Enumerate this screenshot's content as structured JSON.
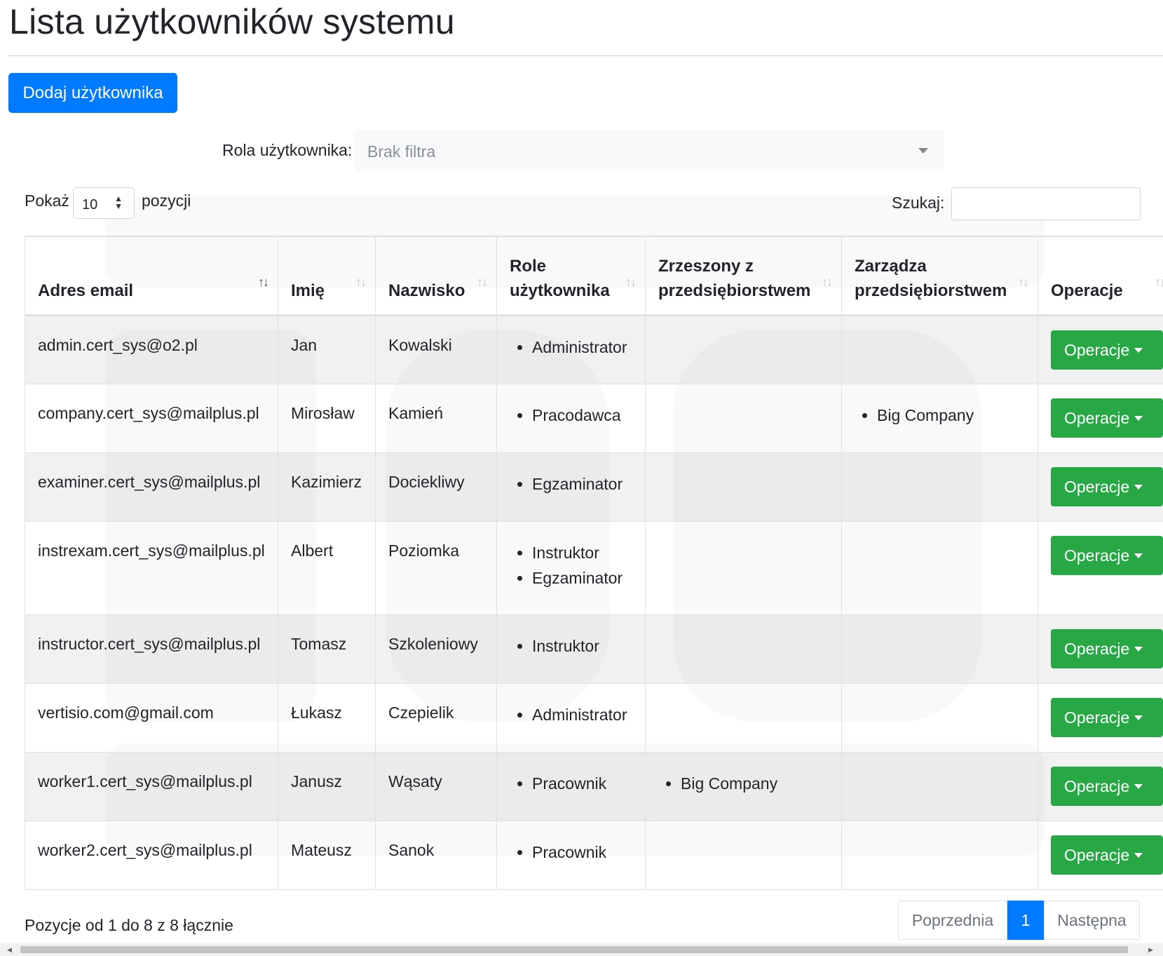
{
  "page": {
    "title": "Lista użytkowników systemu"
  },
  "toolbar": {
    "add_user_label": "Dodaj użytkownika"
  },
  "filter": {
    "label": "Rola użytkownika:",
    "value": "Brak filtra"
  },
  "length": {
    "prefix": "Pokaż",
    "value": "10",
    "suffix": "pozycji"
  },
  "search": {
    "label": "Szukaj:",
    "value": ""
  },
  "table": {
    "headers": {
      "email": "Adres email",
      "first_name": "Imię",
      "last_name": "Nazwisko",
      "roles": "Role użytkownika",
      "member_of": "Zrzeszony z przedsiębiorstwem",
      "manages": "Zarządza przedsiębiorstwem",
      "operations": "Operacje"
    },
    "rows": [
      {
        "email": "admin.cert_sys@o2.pl",
        "first_name": "Jan",
        "last_name": "Kowalski",
        "roles": [
          "Administrator"
        ],
        "member_of": [],
        "manages": [],
        "operations": "Operacje"
      },
      {
        "email": "company.cert_sys@mailplus.pl",
        "first_name": "Mirosław",
        "last_name": "Kamień",
        "roles": [
          "Pracodawca"
        ],
        "member_of": [],
        "manages": [
          "Big Company"
        ],
        "operations": "Operacje"
      },
      {
        "email": "examiner.cert_sys@mailplus.pl",
        "first_name": "Kazimierz",
        "last_name": "Dociekliwy",
        "roles": [
          "Egzaminator"
        ],
        "member_of": [],
        "manages": [],
        "operations": "Operacje"
      },
      {
        "email": "instrexam.cert_sys@mailplus.pl",
        "first_name": "Albert",
        "last_name": "Poziomka",
        "roles": [
          "Instruktor",
          "Egzaminator"
        ],
        "member_of": [],
        "manages": [],
        "operations": "Operacje"
      },
      {
        "email": "instructor.cert_sys@mailplus.pl",
        "first_name": "Tomasz",
        "last_name": "Szkoleniowy",
        "roles": [
          "Instruktor"
        ],
        "member_of": [],
        "manages": [],
        "operations": "Operacje"
      },
      {
        "email": "vertisio.com@gmail.com",
        "first_name": "Łukasz",
        "last_name": "Czepielik",
        "roles": [
          "Administrator"
        ],
        "member_of": [],
        "manages": [],
        "operations": "Operacje"
      },
      {
        "email": "worker1.cert_sys@mailplus.pl",
        "first_name": "Janusz",
        "last_name": "Wąsaty",
        "roles": [
          "Pracownik"
        ],
        "member_of": [
          "Big Company"
        ],
        "manages": [],
        "operations": "Operacje"
      },
      {
        "email": "worker2.cert_sys@mailplus.pl",
        "first_name": "Mateusz",
        "last_name": "Sanok",
        "roles": [
          "Pracownik"
        ],
        "member_of": [],
        "manages": [],
        "operations": "Operacje"
      }
    ]
  },
  "info": "Pozycje od 1 do 8 z 8 łącznie",
  "pagination": {
    "previous": "Poprzednia",
    "current": "1",
    "next": "Następna"
  }
}
